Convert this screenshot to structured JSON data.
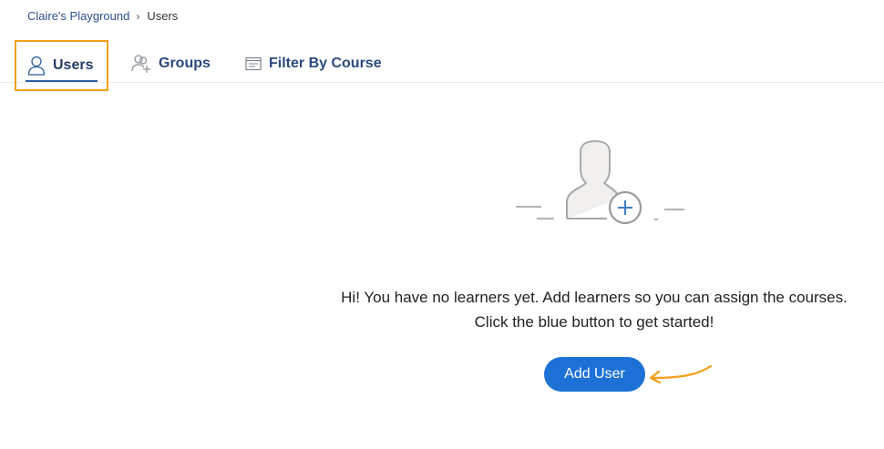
{
  "breadcrumb": {
    "parent": "Claire's Playground",
    "separator": "›",
    "current": "Users"
  },
  "tabs": [
    {
      "label": "Users",
      "icon": "user-icon",
      "active": true
    },
    {
      "label": "Groups",
      "icon": "group-add-icon",
      "active": false
    },
    {
      "label": "Filter By Course",
      "icon": "course-icon",
      "active": false
    }
  ],
  "empty_state": {
    "illustration_icon": "add-user-illustration-icon",
    "line1": "Hi! You have no learners yet. Add learners so you can assign the courses.",
    "line2": "Click the blue button to get started!",
    "button_label": "Add User"
  },
  "colors": {
    "highlight": "#f59f1c",
    "primary_button": "#1d71d6",
    "tab_text": "#2b4a7c"
  }
}
